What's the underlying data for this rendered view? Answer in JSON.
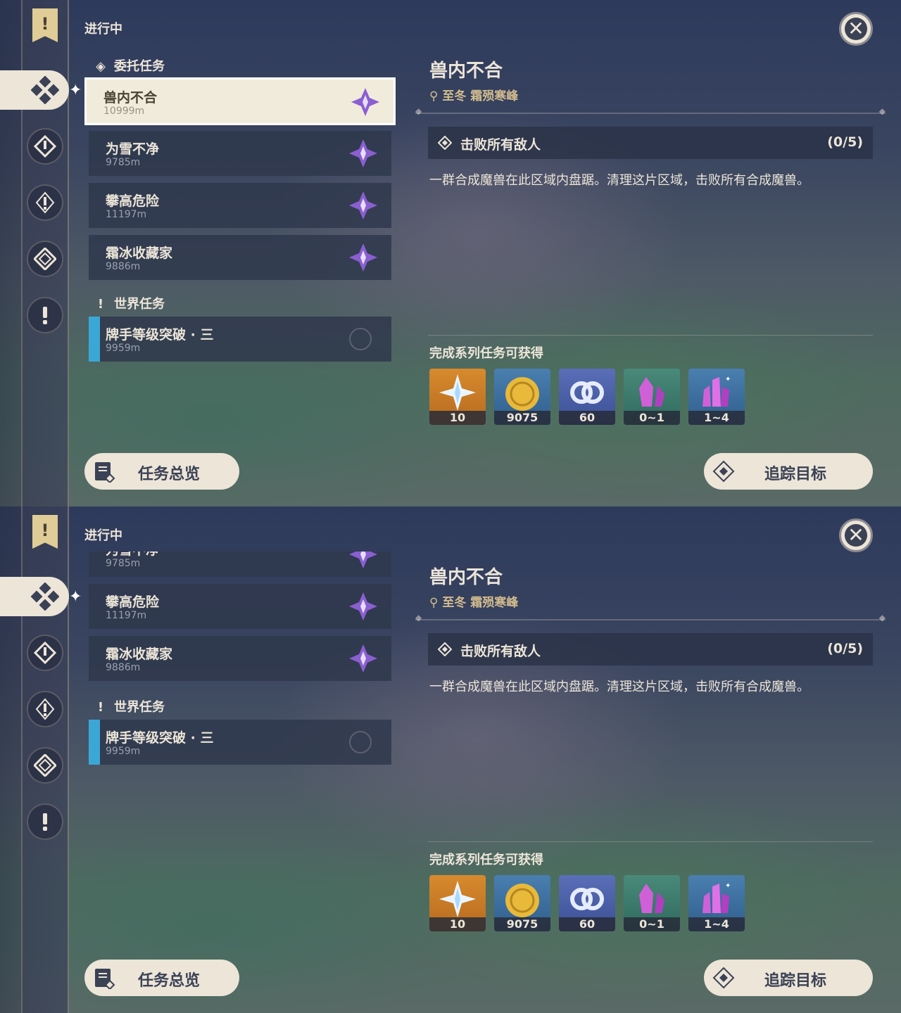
{
  "status_label": "进行中",
  "sections": {
    "commission": "委托任务",
    "world": "世界任务"
  },
  "commissions": [
    {
      "name": "兽内不合",
      "distance": "10999m"
    },
    {
      "name": "为雪不净",
      "distance": "9785m"
    },
    {
      "name": "攀高危险",
      "distance": "11197m"
    },
    {
      "name": "霜冰收藏家",
      "distance": "9886m"
    }
  ],
  "world_quests": [
    {
      "name": "牌手等级突破 · 三",
      "distance": "9959m"
    }
  ],
  "detail": {
    "title": "兽内不合",
    "location": "至冬 霜殒寒峰",
    "objective": "击败所有敌人",
    "progress": "(0/5)",
    "description": "一群合成魔兽在此区域内盘踞。清理这片区域，击败所有合成魔兽。",
    "rewards_title": "完成系列任务可获得",
    "rewards": [
      {
        "icon": "primogem-icon",
        "count": "10"
      },
      {
        "icon": "mora-icon",
        "count": "9075"
      },
      {
        "icon": "companionship-exp-icon",
        "count": "60"
      },
      {
        "icon": "crystal-icon",
        "count": "0~1"
      },
      {
        "icon": "crystal-cluster-icon",
        "count": "1~4"
      }
    ]
  },
  "buttons": {
    "overview": "任务总览",
    "track": "追踪目标"
  },
  "colors": {
    "accent": "#ece5d8",
    "gold": "#d3bc8e",
    "world_bar": "#3ba7d6",
    "commission_icon": "#8a5fd1"
  }
}
